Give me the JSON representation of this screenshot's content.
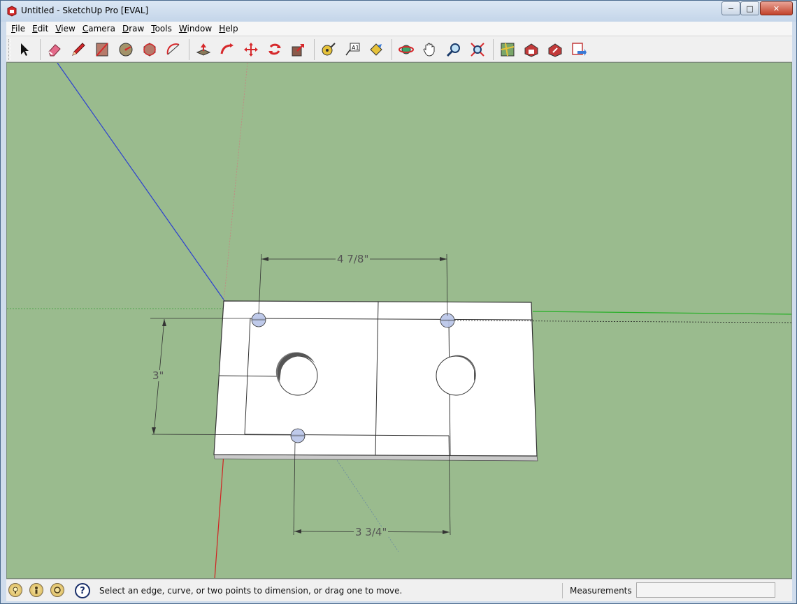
{
  "window": {
    "title": "Untitled - SketchUp Pro [EVAL]",
    "controls": {
      "minimize": "−",
      "maximize": "□",
      "close": "✕"
    }
  },
  "menubar": {
    "items": [
      {
        "label": "File",
        "accel": "F",
        "rest": "ile"
      },
      {
        "label": "Edit",
        "accel": "E",
        "rest": "dit"
      },
      {
        "label": "View",
        "accel": "V",
        "rest": "iew"
      },
      {
        "label": "Camera",
        "accel": "C",
        "rest": "amera"
      },
      {
        "label": "Draw",
        "accel": "D",
        "rest": "raw"
      },
      {
        "label": "Tools",
        "accel": "T",
        "rest": "ools"
      },
      {
        "label": "Window",
        "accel": "W",
        "rest": "indow"
      },
      {
        "label": "Help",
        "accel": "H",
        "rest": "elp"
      }
    ]
  },
  "toolbar": {
    "tools": [
      "select-icon",
      "eraser-icon",
      "pencil-line-icon",
      "rectangle-icon",
      "circle-icon",
      "polygon-icon",
      "arc-icon",
      "push-pull-icon",
      "follow-me-icon",
      "move-icon",
      "rotate-icon",
      "scale-icon",
      "tape-measure-icon",
      "text-icon",
      "paint-bucket-icon",
      "orbit-icon",
      "pan-icon",
      "zoom-icon",
      "zoom-extents-icon",
      "add-location-icon",
      "3d-warehouse-icon",
      "share-model-icon",
      "extension-warehouse-icon"
    ]
  },
  "viewport": {
    "background": "#9abb8e",
    "dimensions": {
      "top": "4 7/8\"",
      "left": "3\"",
      "bottom": "3 3/4\""
    }
  },
  "statusbar": {
    "message": "Select an edge, curve, or two points to dimension, or drag one to move.",
    "measurements_label": "Measurements",
    "measurements_value": ""
  }
}
